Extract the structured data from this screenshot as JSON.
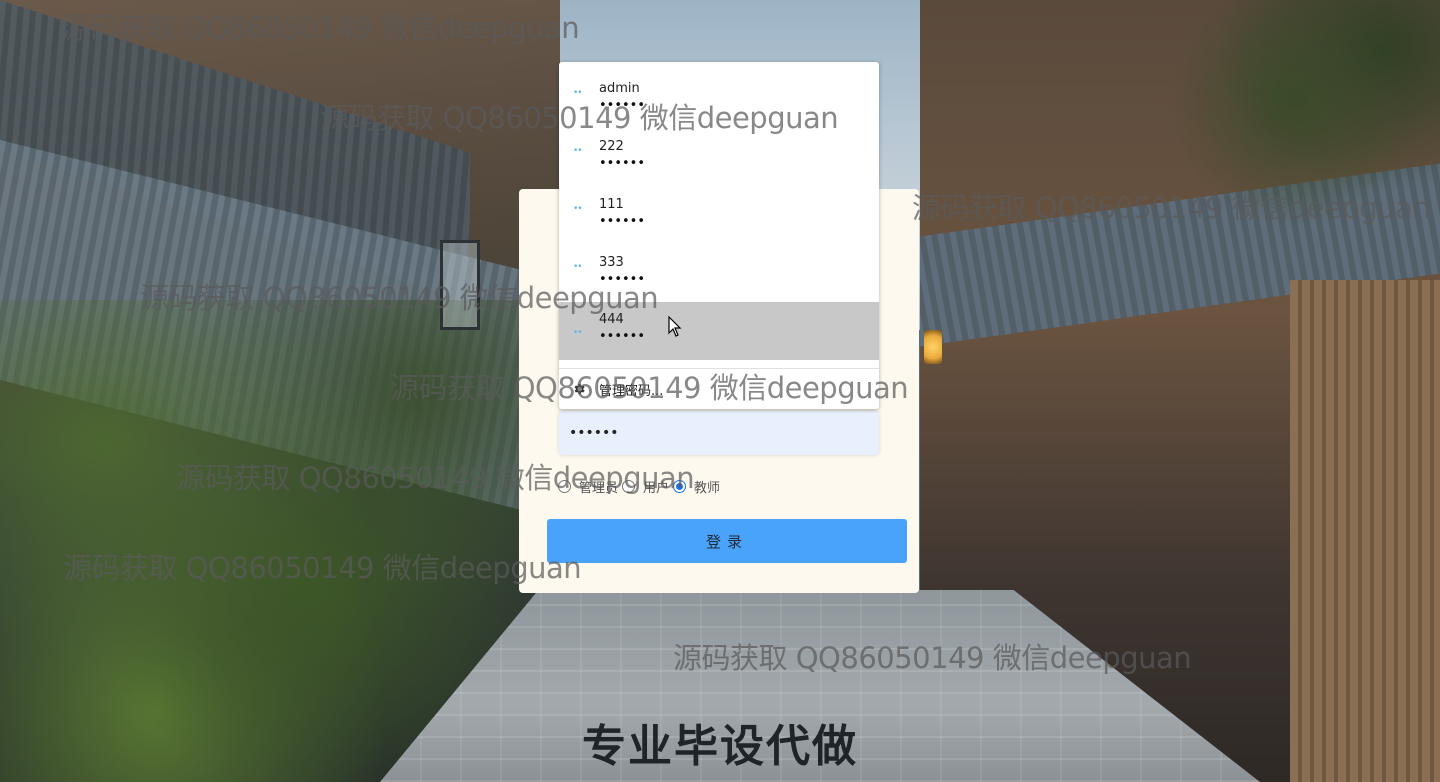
{
  "autofill": {
    "entries": [
      {
        "username": "admin",
        "password_mask": "••••••"
      },
      {
        "username": "222",
        "password_mask": "••••••"
      },
      {
        "username": "111",
        "password_mask": "••••••"
      },
      {
        "username": "333",
        "password_mask": "••••••"
      },
      {
        "username": "444",
        "password_mask": "••••••"
      }
    ],
    "key_glyph": "••",
    "manage_label": "管理密码..."
  },
  "login": {
    "password_value": "••••••",
    "roles": [
      {
        "label": "管理员",
        "checked": false
      },
      {
        "label": "用户",
        "checked": false
      },
      {
        "label": "教师",
        "checked": true
      }
    ],
    "button_label": "登录"
  },
  "watermark_text": "源码获取 QQ86050149 微信deepguan",
  "banner": "专业毕设代做",
  "colors": {
    "card_bg": "#fdf9ee",
    "button_bg": "#4aa3fa",
    "input_bg": "#e8f0fe",
    "hover_bg": "#c8c8c8",
    "key_icon": "#5fb6e9"
  }
}
